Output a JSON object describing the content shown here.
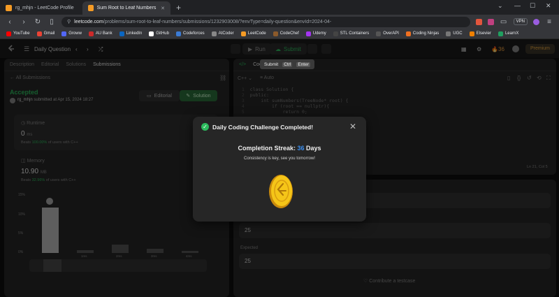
{
  "browser": {
    "tabs": [
      {
        "label": "rg_mhjn - LeetCode Profile",
        "active": false
      },
      {
        "label": "Sum Root to Leaf Numbers - Lee",
        "active": true
      }
    ],
    "url_domain": "leetcode.com",
    "url_path": "/problems/sum-root-to-leaf-numbers/submissions/1232903008/?envType=daily-question&envId=2024-04-",
    "vpn_label": "VPN",
    "bookmarks": [
      "YouTube",
      "Gmail",
      "Groww",
      "AU Bank",
      "LinkedIn",
      "GitHub",
      "Codeforces",
      "AtCoder",
      "LeetCode",
      "CodeChef",
      "Udemy",
      "STL Containers",
      "OverAPI",
      "Coding Ninjas",
      "UGC",
      "Elsevier",
      "LearnX"
    ]
  },
  "lc_nav": {
    "daily_label": "Daily Question",
    "run_label": "Run",
    "submit_label": "Submit",
    "streak_count": "36",
    "premium_label": "Premium"
  },
  "tooltip": {
    "label": "Submit",
    "key1": "Ctrl",
    "key2": "Enter"
  },
  "left": {
    "tabs": [
      "Description",
      "Editorial",
      "Solutions",
      "Submissions"
    ],
    "back_label": "All Submissions",
    "status": "Accepted",
    "user": "rg_mhjn",
    "submitted": "submitted at Apr 15, 2024 18:27",
    "editorial_btn": "Editorial",
    "solution_btn": "Solution",
    "runtime_label": "Runtime",
    "runtime_value": "0",
    "runtime_unit": "ms",
    "runtime_beats_label": "Beats",
    "runtime_beats": "100.00%",
    "runtime_suffix": "of users with C++",
    "memory_label": "Memory",
    "memory_value": "10.90",
    "memory_unit": "MB",
    "memory_beats_label": "Beats",
    "memory_beats": "32.96%",
    "memory_suffix": "of users with C++",
    "y_ticks": [
      "15%",
      "10%",
      "5%",
      "0%"
    ],
    "x_ticks": [
      "1ms",
      "2ms",
      "3ms",
      "4ms"
    ]
  },
  "code": {
    "tab_label": "Code",
    "lang": "C++",
    "mode": "Auto",
    "lines": [
      "class Solution {",
      "public:",
      "    int sumNumbers(TreeNode* root) {",
      "        if (root == nullptr){",
      "            return 0;"
    ],
    "cursor": "Ln 21, Col 5"
  },
  "testcase": {
    "output_value": "25",
    "expected_label": "Expected",
    "expected_value": "25",
    "contribute_label": "Contribute a testcase"
  },
  "modal": {
    "title": "Daily Coding Challenge Completed!",
    "streak_prefix": "Completion Streak:",
    "streak_num": "36",
    "streak_suffix": "Days",
    "subtitle": "Consistency is key, see you tomorrow!"
  },
  "colors": {
    "accent_green": "#2cbb5d",
    "accent_blue": "#3b8ff0",
    "premium": "#e8a640",
    "coin": "#f5c518"
  }
}
